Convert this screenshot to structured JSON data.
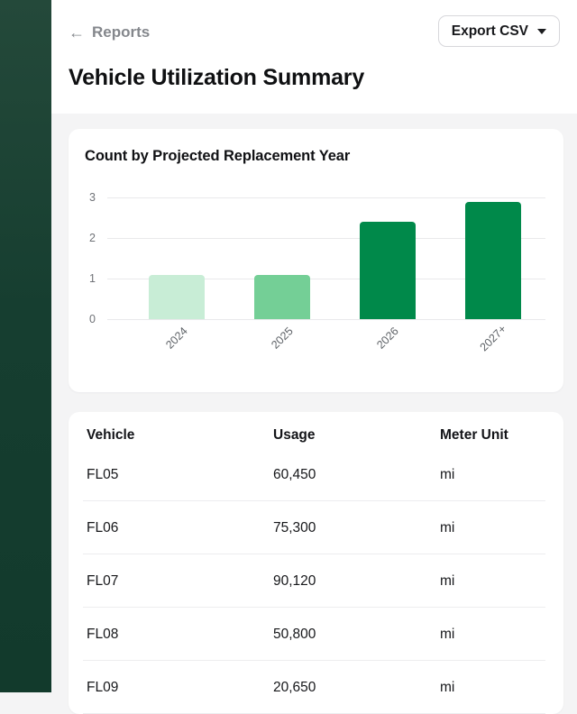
{
  "header": {
    "back_arrow": "←",
    "back_label": "Reports",
    "export_button": {
      "label": "Export CSV"
    },
    "title": "Vehicle Utilization Summary"
  },
  "chart_data": {
    "type": "bar",
    "title": "Count by Projected Replacement Year",
    "categories": [
      "2024",
      "2025",
      "2026",
      "2027+"
    ],
    "values": [
      1.1,
      1.1,
      2.4,
      2.9
    ],
    "bar_colors": [
      "#C8EDD6",
      "#74CF96",
      "#00894A",
      "#00894A"
    ],
    "ylim": [
      0,
      3
    ],
    "yticks": [
      0,
      1,
      2,
      3
    ],
    "grid": true,
    "xlabel": "",
    "ylabel": "",
    "legend": "none"
  },
  "table": {
    "columns": [
      "Vehicle",
      "Usage",
      "Meter Unit"
    ],
    "rows": [
      {
        "vehicle": "FL05",
        "usage": "60,450",
        "meter_unit": "mi"
      },
      {
        "vehicle": "FL06",
        "usage": "75,300",
        "meter_unit": "mi"
      },
      {
        "vehicle": "FL07",
        "usage": "90,120",
        "meter_unit": "mi"
      },
      {
        "vehicle": "FL08",
        "usage": "50,800",
        "meter_unit": "mi"
      },
      {
        "vehicle": "FL09",
        "usage": "20,650",
        "meter_unit": "mi"
      }
    ]
  },
  "colors": {
    "sidebar_green_top": "#24493A",
    "sidebar_green_bottom": "#123A2C",
    "page_background": "#F4F4F5",
    "card_background": "#FFFFFF",
    "accent_green": "#00894A",
    "muted_text": "#84878C",
    "grid_line": "#E9E9EB",
    "row_separator": "#EDEDEF"
  }
}
